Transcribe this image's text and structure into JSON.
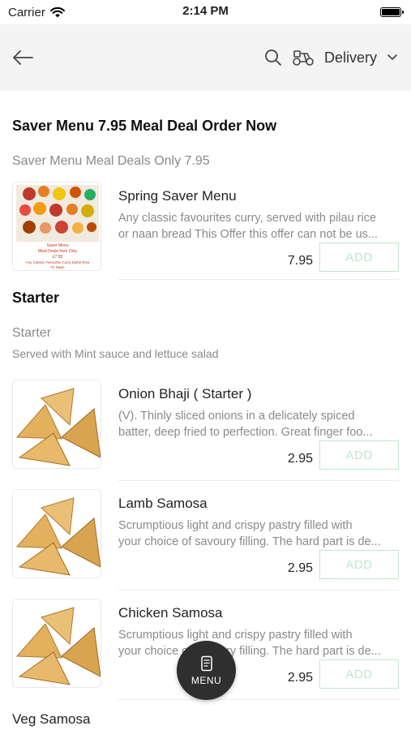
{
  "status_bar": {
    "carrier": "Carrier",
    "time": "2:14 PM"
  },
  "nav": {
    "delivery_label": "Delivery"
  },
  "sections": [
    {
      "title": "Saver Menu 7.95 Meal Deal Order Now",
      "subheading": "Saver Menu Meal Deals Only 7.95",
      "items": [
        {
          "name": "Spring Saver Menu",
          "desc1": "Any classic favourites curry, served with pilau rice",
          "desc2": "or naan bread This Offer  this offer can not be us...",
          "price": "7.95",
          "add": "ADD",
          "image_text": [
            "Saver Menu",
            "Meal Deals from Only",
            "£7.95",
            "Any Classic Favourite Curry Dishe Rice",
            "Or Naan"
          ]
        }
      ]
    },
    {
      "title": "Starter",
      "subheading": "Starter",
      "description": "Served with Mint sauce and lettuce salad",
      "items": [
        {
          "name": "Onion Bhaji ( Starter )",
          "desc1": "(V). Thinly sliced onions in a delicately spiced",
          "desc2": "batter, deep fried to perfection. Great finger foo...",
          "price": "2.95",
          "add": "ADD"
        },
        {
          "name": "Lamb Samosa",
          "desc1": "Scrumptious light and crispy pastry filled with",
          "desc2": "your choice of savoury filling. The hard part is de...",
          "price": "2.95",
          "add": "ADD"
        },
        {
          "name": "Chicken Samosa",
          "desc1": "Scrumptious light and crispy pastry filled with",
          "desc2": "your choice of savoury filling. The hard part is de...",
          "price": "2.95",
          "add": "ADD"
        },
        {
          "name": "Veg Samosa"
        }
      ]
    }
  ],
  "fab": {
    "label": "MENU"
  },
  "colors": {
    "add_border": "#bfe6cc",
    "nav_bg": "#f4f4f4",
    "fab_bg": "#2f2f2f"
  }
}
